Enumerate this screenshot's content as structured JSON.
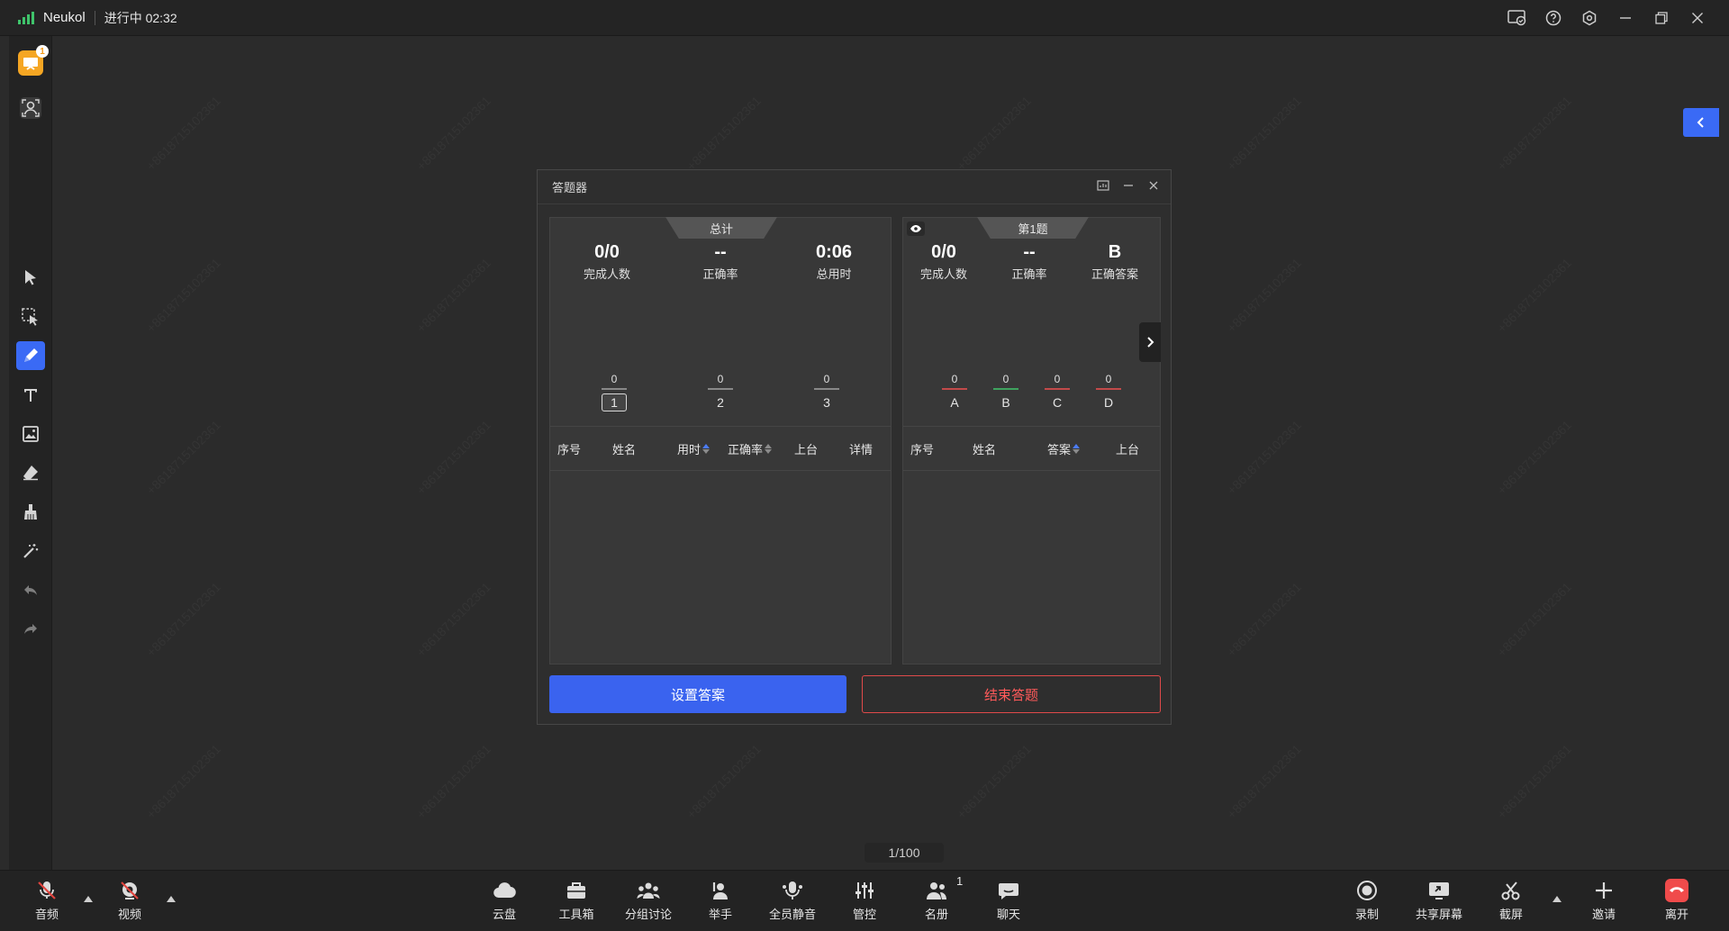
{
  "titlebar": {
    "app_name": "Neukol",
    "status": "进行中 02:32"
  },
  "left_toolbar": {
    "notification_count": "1"
  },
  "watermark": "+8618715102361",
  "page_indicator": "1/100",
  "dialog": {
    "title": "答题器",
    "summary": {
      "tab": "总计",
      "stats": [
        {
          "value": "0/0",
          "label": "完成人数"
        },
        {
          "value": "--",
          "label": "正确率"
        },
        {
          "value": "0:06",
          "label": "总用时"
        }
      ],
      "bars": [
        {
          "count": "0",
          "label": "1",
          "selected": true
        },
        {
          "count": "0",
          "label": "2",
          "selected": false
        },
        {
          "count": "0",
          "label": "3",
          "selected": false
        }
      ],
      "columns": [
        "序号",
        "姓名",
        "用时",
        "正确率",
        "上台",
        "详情"
      ]
    },
    "question": {
      "tab": "第1题",
      "stats": [
        {
          "value": "0/0",
          "label": "完成人数"
        },
        {
          "value": "--",
          "label": "正确率"
        },
        {
          "value": "B",
          "label": "正确答案"
        }
      ],
      "options": [
        {
          "count": "0",
          "label": "A",
          "color": "#e05555"
        },
        {
          "count": "0",
          "label": "B",
          "color": "#3fc36b"
        },
        {
          "count": "0",
          "label": "C",
          "color": "#e05555"
        },
        {
          "count": "0",
          "label": "D",
          "color": "#e05555"
        }
      ],
      "columns": [
        "序号",
        "姓名",
        "答案",
        "上台"
      ]
    },
    "primary_button": "设置答案",
    "danger_button": "结束答题"
  },
  "bottom_toolbar": {
    "left": [
      {
        "label": "音频",
        "icon": "mic-off-icon"
      },
      {
        "label": "视频",
        "icon": "camera-off-icon"
      }
    ],
    "center": [
      {
        "label": "云盘",
        "icon": "cloud-icon"
      },
      {
        "label": "工具箱",
        "icon": "toolbox-icon"
      },
      {
        "label": "分组讨论",
        "icon": "group-icon"
      },
      {
        "label": "举手",
        "icon": "hand-raise-icon"
      },
      {
        "label": "全员静音",
        "icon": "mute-all-icon"
      },
      {
        "label": "管控",
        "icon": "controls-icon"
      },
      {
        "label": "名册",
        "icon": "roster-icon",
        "count": "1"
      },
      {
        "label": "聊天",
        "icon": "chat-icon"
      }
    ],
    "right": [
      {
        "label": "录制",
        "icon": "record-icon"
      },
      {
        "label": "共享屏幕",
        "icon": "share-screen-icon"
      },
      {
        "label": "截屏",
        "icon": "screenshot-icon"
      },
      {
        "label": "邀请",
        "icon": "invite-icon"
      },
      {
        "label": "离开",
        "icon": "leave-icon"
      }
    ]
  }
}
